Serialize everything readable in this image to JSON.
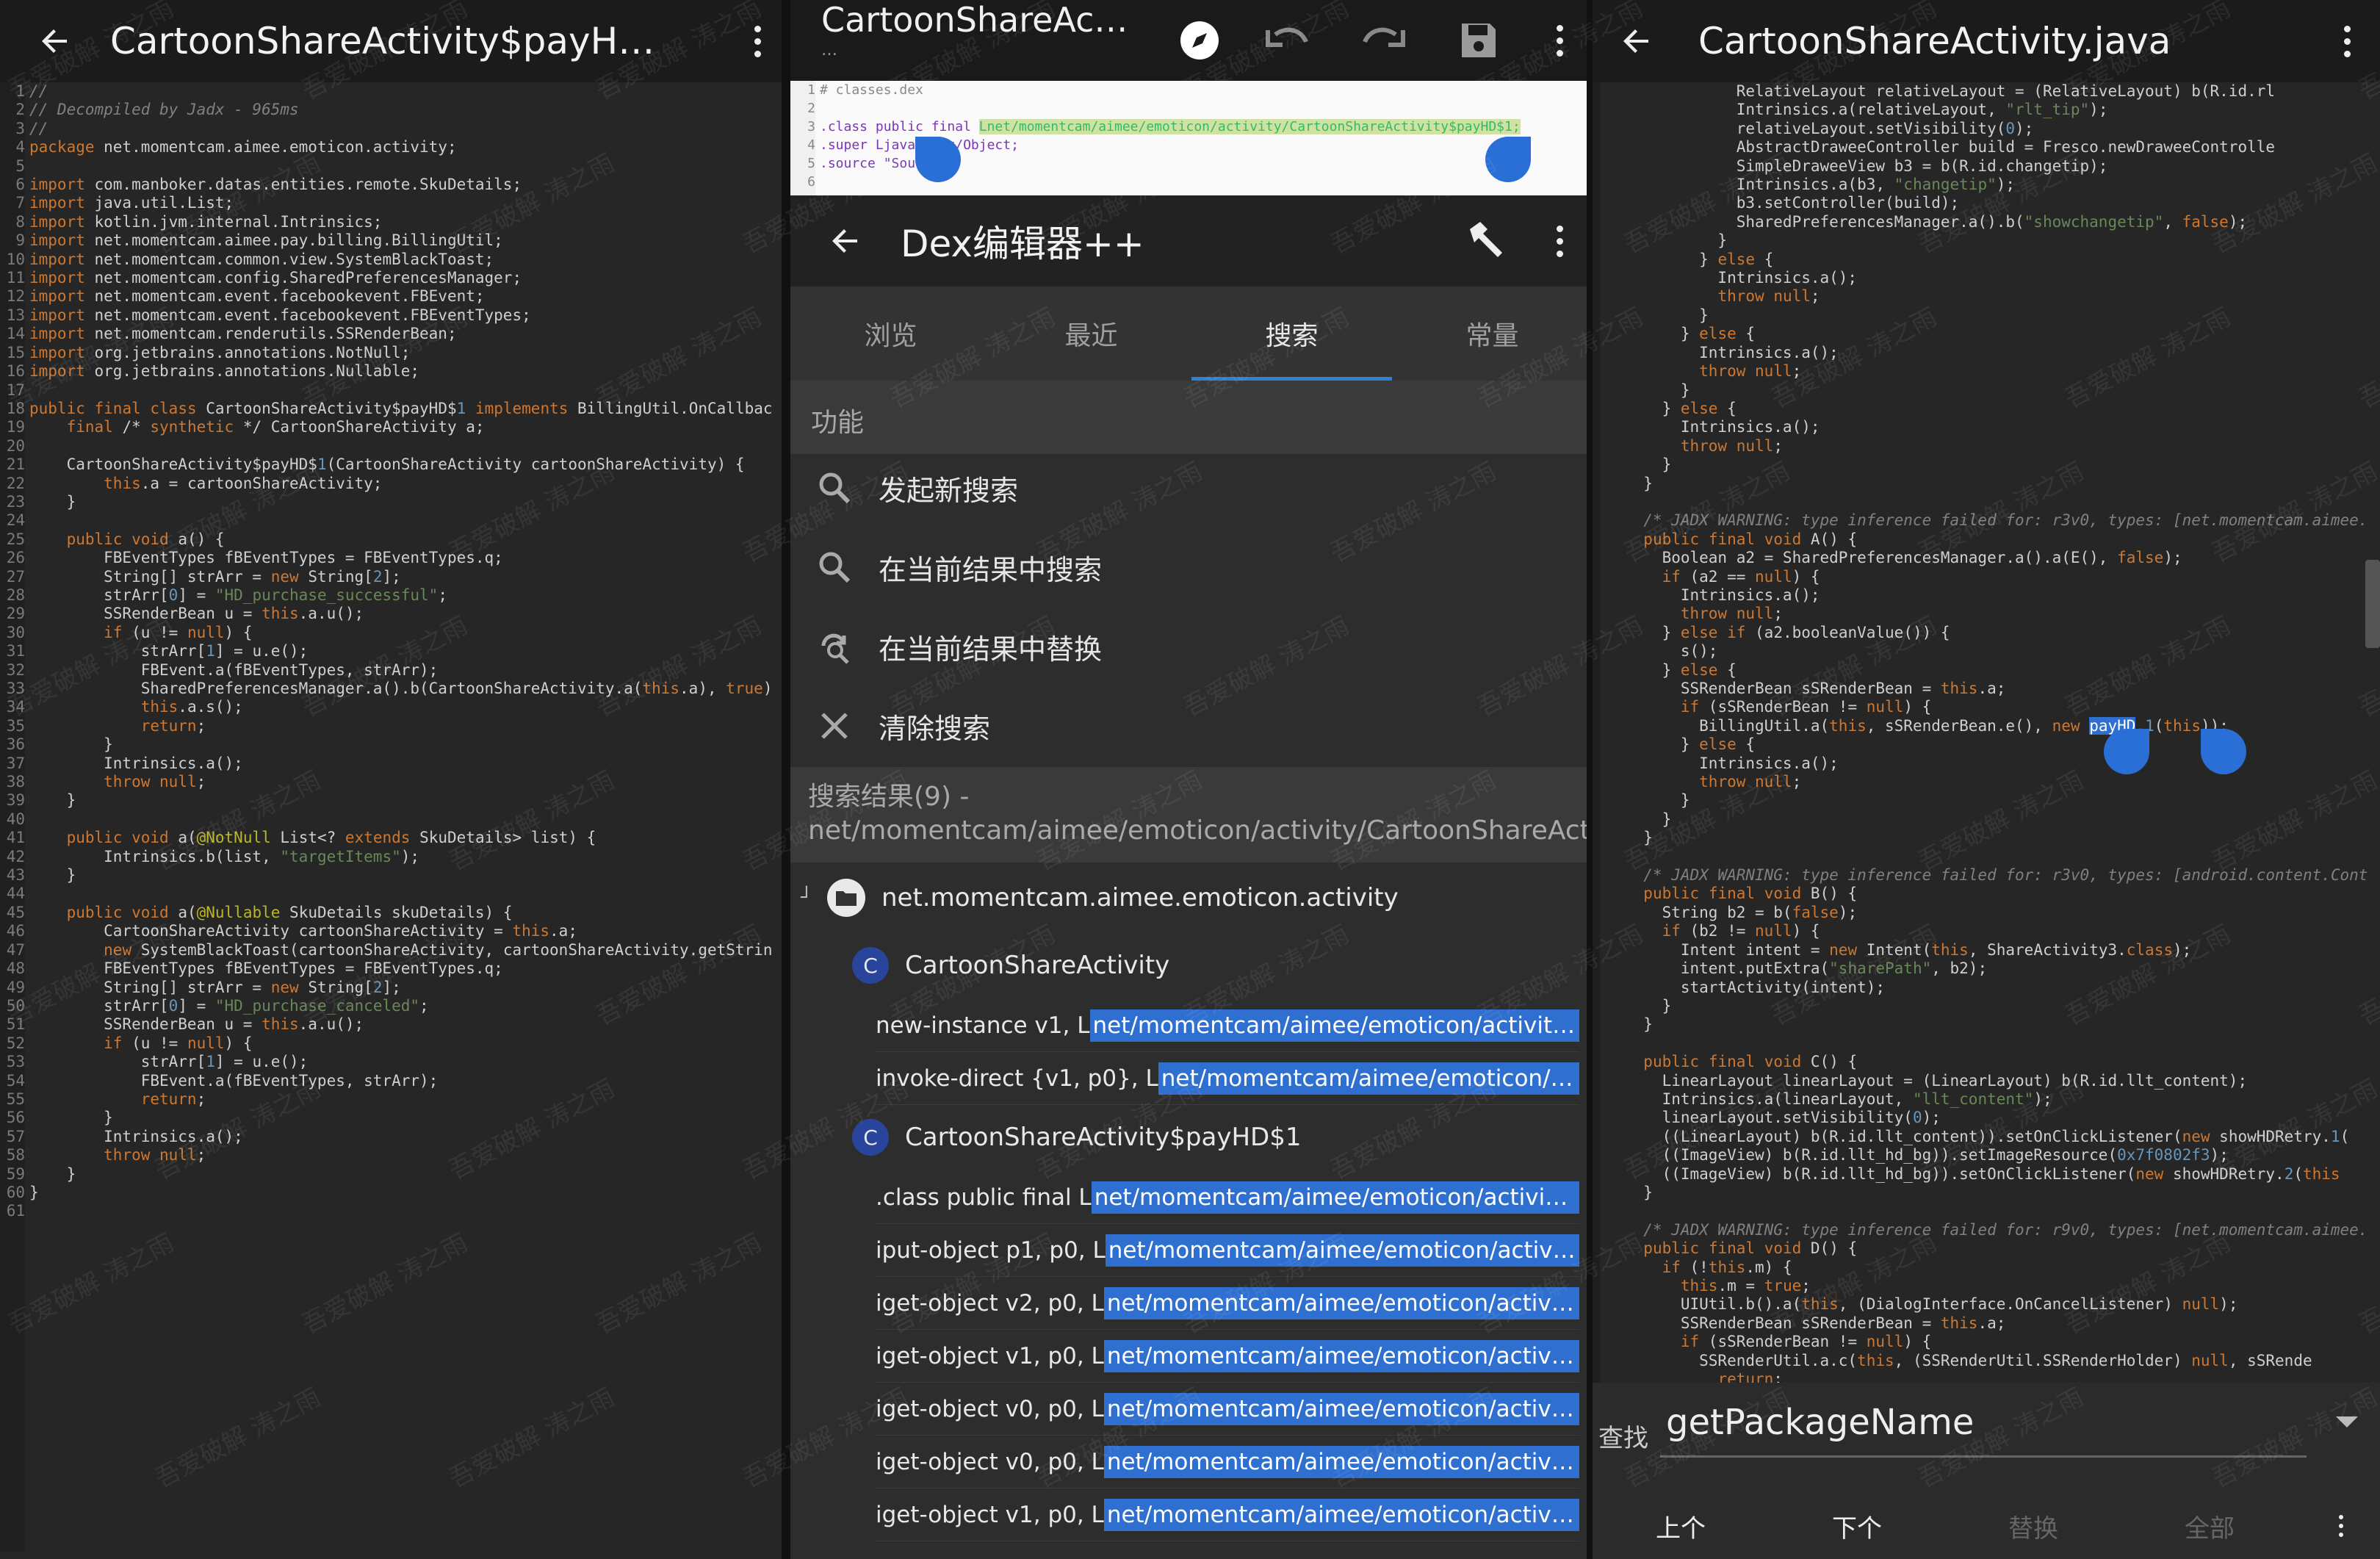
{
  "left_panel": {
    "title": "CartoonShareActivity$payH…",
    "code_lines": [
      "//",
      "// Decompiled by Jadx - 965ms",
      "//",
      "package net.momentcam.aimee.emoticon.activity;",
      "",
      "import com.manboker.datas.entities.remote.SkuDetails;",
      "import java.util.List;",
      "import kotlin.jvm.internal.Intrinsics;",
      "import net.momentcam.aimee.pay.billing.BillingUtil;",
      "import net.momentcam.common.view.SystemBlackToast;",
      "import net.momentcam.config.SharedPreferencesManager;",
      "import net.momentcam.event.facebookevent.FBEvent;",
      "import net.momentcam.event.facebookevent.FBEventTypes;",
      "import net.momentcam.renderutils.SSRenderBean;",
      "import org.jetbrains.annotations.NotNull;",
      "import org.jetbrains.annotations.Nullable;",
      "",
      "public final class CartoonShareActivity$payHD$1 implements BillingUtil.OnCallbac",
      "    final /* synthetic */ CartoonShareActivity a;",
      "",
      "    CartoonShareActivity$payHD$1(CartoonShareActivity cartoonShareActivity) {",
      "        this.a = cartoonShareActivity;",
      "    }",
      "",
      "    public void a() {",
      "        FBEventTypes fBEventTypes = FBEventTypes.q;",
      "        String[] strArr = new String[2];",
      "        strArr[0] = \"HD_purchase_successful\";",
      "        SSRenderBean u = this.a.u();",
      "        if (u != null) {",
      "            strArr[1] = u.e();",
      "            FBEvent.a(fBEventTypes, strArr);",
      "            SharedPreferencesManager.a().b(CartoonShareActivity.a(this.a), true)",
      "            this.a.s();",
      "            return;",
      "        }",
      "        Intrinsics.a();",
      "        throw null;",
      "    }",
      "",
      "    public void a(@NotNull List<? extends SkuDetails> list) {",
      "        Intrinsics.b(list, \"targetItems\");",
      "    }",
      "",
      "    public void a(@Nullable SkuDetails skuDetails) {",
      "        CartoonShareActivity cartoonShareActivity = this.a;",
      "        new SystemBlackToast(cartoonShareActivity, cartoonShareActivity.getStrin",
      "        FBEventTypes fBEventTypes = FBEventTypes.q;",
      "        String[] strArr = new String[2];",
      "        strArr[0] = \"HD_purchase_canceled\";",
      "        SSRenderBean u = this.a.u();",
      "        if (u != null) {",
      "            strArr[1] = u.e();",
      "            FBEvent.a(fBEventTypes, strArr);",
      "            return;",
      "        }",
      "        Intrinsics.a();",
      "        throw null;",
      "    }",
      "}",
      ""
    ]
  },
  "middle_panel": {
    "smali_title": "CartoonShareAc…",
    "smali_subtitle": "…",
    "smali_lines": [
      "# classes.dex",
      "",
      ".class public final Lnet/momentcam/aimee/emoticon/activity/CartoonShareActivity$payHD$1;",
      ".super Ljava/lang/Object;",
      ".source \"Sour",
      ""
    ],
    "app_title": "Dex编辑器++",
    "tabs": [
      "浏览",
      "最近",
      "搜索",
      "常量"
    ],
    "active_tab": 2,
    "section_label": "功能",
    "menu": [
      {
        "label": "发起新搜索",
        "icon": "search-icon"
      },
      {
        "label": "在当前结果中搜索",
        "icon": "search-icon"
      },
      {
        "label": "在当前结果中替换",
        "icon": "replace-icon"
      },
      {
        "label": "清除搜索",
        "icon": "close-icon"
      }
    ],
    "results_header": "搜索结果(9) - net/momentcam/aimee/emoticon/activity/CartoonShareActivity$payHD$1;",
    "package_node": "net.momentcam.aimee.emoticon.activity",
    "class_badge": "C",
    "classes": [
      {
        "name": "CartoonShareActivity",
        "rows": [
          {
            "prefix": "new-instance v1, L",
            "match": "net/momentcam/aimee/emoticon/activity/Car…"
          },
          {
            "prefix": "invoke-direct {v1, p0}, L",
            "match": "net/momentcam/aimee/emoticon/activity…"
          }
        ]
      },
      {
        "name": "CartoonShareActivity$payHD$1",
        "rows": [
          {
            "prefix": ".class public final L",
            "match": "net/momentcam/aimee/emoticon/activity/Ca…"
          },
          {
            "prefix": "iput-object p1, p0, L",
            "match": "net/momentcam/aimee/emoticon/activity/Ca…"
          },
          {
            "prefix": "iget-object v2, p0, L",
            "match": "net/momentcam/aimee/emoticon/activity/Ca…"
          },
          {
            "prefix": "iget-object v1, p0, L",
            "match": "net/momentcam/aimee/emoticon/activity/Ca…"
          },
          {
            "prefix": "iget-object v0, p0, L",
            "match": "net/momentcam/aimee/emoticon/activity/Ca…"
          },
          {
            "prefix": "iget-object v0, p0, L",
            "match": "net/momentcam/aimee/emoticon/activity/Ca…"
          },
          {
            "prefix": "iget-object v1, p0, L",
            "match": "net/momentcam/aimee/emoticon/activity/Ca…"
          }
        ]
      }
    ]
  },
  "right_panel": {
    "title": "CartoonShareActivity.java",
    "code_lines": [
      "            RelativeLayout relativeLayout = (RelativeLayout) b(R.id.rl",
      "            Intrinsics.a(relativeLayout, \"rlt_tip\");",
      "            relativeLayout.setVisibility(0);",
      "            AbstractDraweeController build = Fresco.newDraweeControlle",
      "            SimpleDraweeView b3 = b(R.id.changetip);",
      "            Intrinsics.a(b3, \"changetip\");",
      "            b3.setController(build);",
      "            SharedPreferencesManager.a().b(\"showchangetip\", false);",
      "          }",
      "        } else {",
      "          Intrinsics.a();",
      "          throw null;",
      "        }",
      "      } else {",
      "        Intrinsics.a();",
      "        throw null;",
      "      }",
      "    } else {",
      "      Intrinsics.a();",
      "      throw null;",
      "    }",
      "  }",
      "",
      "  /* JADX WARNING: type inference failed for: r3v0, types: [net.momentcam.aimee.",
      "  public final void A() {",
      "    Boolean a2 = SharedPreferencesManager.a().a(E(), false);",
      "    if (a2 == null) {",
      "      Intrinsics.a();",
      "      throw null;",
      "    } else if (a2.booleanValue()) {",
      "      s();",
      "    } else {",
      "      SSRenderBean sSRenderBean = this.a;",
      "      if (sSRenderBean != null) {",
      "        BillingUtil.a(this, sSRenderBean.e(), new payHD.1(this));",
      "      } else {",
      "        Intrinsics.a();",
      "        throw null;",
      "      }",
      "    }",
      "  }",
      "",
      "  /* JADX WARNING: type inference failed for: r3v0, types: [android.content.Cont",
      "  public final void B() {",
      "    String b2 = b(false);",
      "    if (b2 != null) {",
      "      Intent intent = new Intent(this, ShareActivity3.class);",
      "      intent.putExtra(\"sharePath\", b2);",
      "      startActivity(intent);",
      "    }",
      "  }",
      "",
      "  public final void C() {",
      "    LinearLayout linearLayout = (LinearLayout) b(R.id.llt_content);",
      "    Intrinsics.a(linearLayout, \"llt_content\");",
      "    linearLayout.setVisibility(0);",
      "    ((LinearLayout) b(R.id.llt_content)).setOnClickListener(new showHDRetry.1(",
      "    ((ImageView) b(R.id.llt_hd_bg)).setImageResource(0x7f0802f3);",
      "    ((ImageView) b(R.id.llt_hd_bg)).setOnClickListener(new showHDRetry.2(this",
      "  }",
      "",
      "  /* JADX WARNING: type inference failed for: r9v0, types: [net.momentcam.aimee.",
      "  public final void D() {",
      "    if (!this.m) {",
      "      this.m = true;",
      "      UIUtil.b().a(this, (DialogInterface.OnCancelListener) null);",
      "      SSRenderBean sSRenderBean = this.a;",
      "      if (sSRenderBean != null) {",
      "        SSRenderUtil.a.c(this, (SSRenderUtil.SSRenderHolder) null, sSRende",
      "          return;"
    ],
    "find_label": "查找",
    "find_value": "getPackageName",
    "buttons": [
      "上个",
      "下个",
      "替换",
      "全部"
    ]
  },
  "watermark": "吾爱破解 涛之雨",
  "colors": {
    "accent": "#2f7fd4",
    "highlight": "#2e6fd0",
    "badge": "#28459b"
  }
}
